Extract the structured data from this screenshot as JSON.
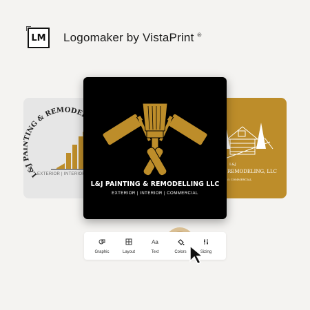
{
  "header": {
    "logo_text": "LM",
    "brand": "Logomaker by VistaPrint",
    "trademark": "®"
  },
  "cards": {
    "left": {
      "title": "L&J PAINTING & REMODELING",
      "subtitle": "EXTERIOR | INTERIOR | COMM"
    },
    "main": {
      "title": "L&J PAINTING & REMODELLING LLC",
      "subtitle": "EXTERIOR | INTERIOR | COMMERCIAL"
    },
    "right": {
      "abbr": "L&J",
      "title": "REMODELING, LLC",
      "subtitle": "& COMMERCIAL"
    }
  },
  "toolbar": {
    "items": [
      {
        "label": "Graphic",
        "icon": "graphic-icon"
      },
      {
        "label": "Layout",
        "icon": "layout-icon"
      },
      {
        "label": "Text",
        "icon": "text-icon"
      },
      {
        "label": "Colors",
        "icon": "paint-bucket-icon"
      },
      {
        "label": "Sizing",
        "icon": "sizing-icon"
      }
    ],
    "text_icon_glyph": "Aa",
    "active": "Colors"
  },
  "colors": {
    "background": "#f4f3f1",
    "gold": "#bd8d2a",
    "main_card": "#000000",
    "left_card": "#e6e6e6",
    "active_tool": "#d9bf94"
  }
}
